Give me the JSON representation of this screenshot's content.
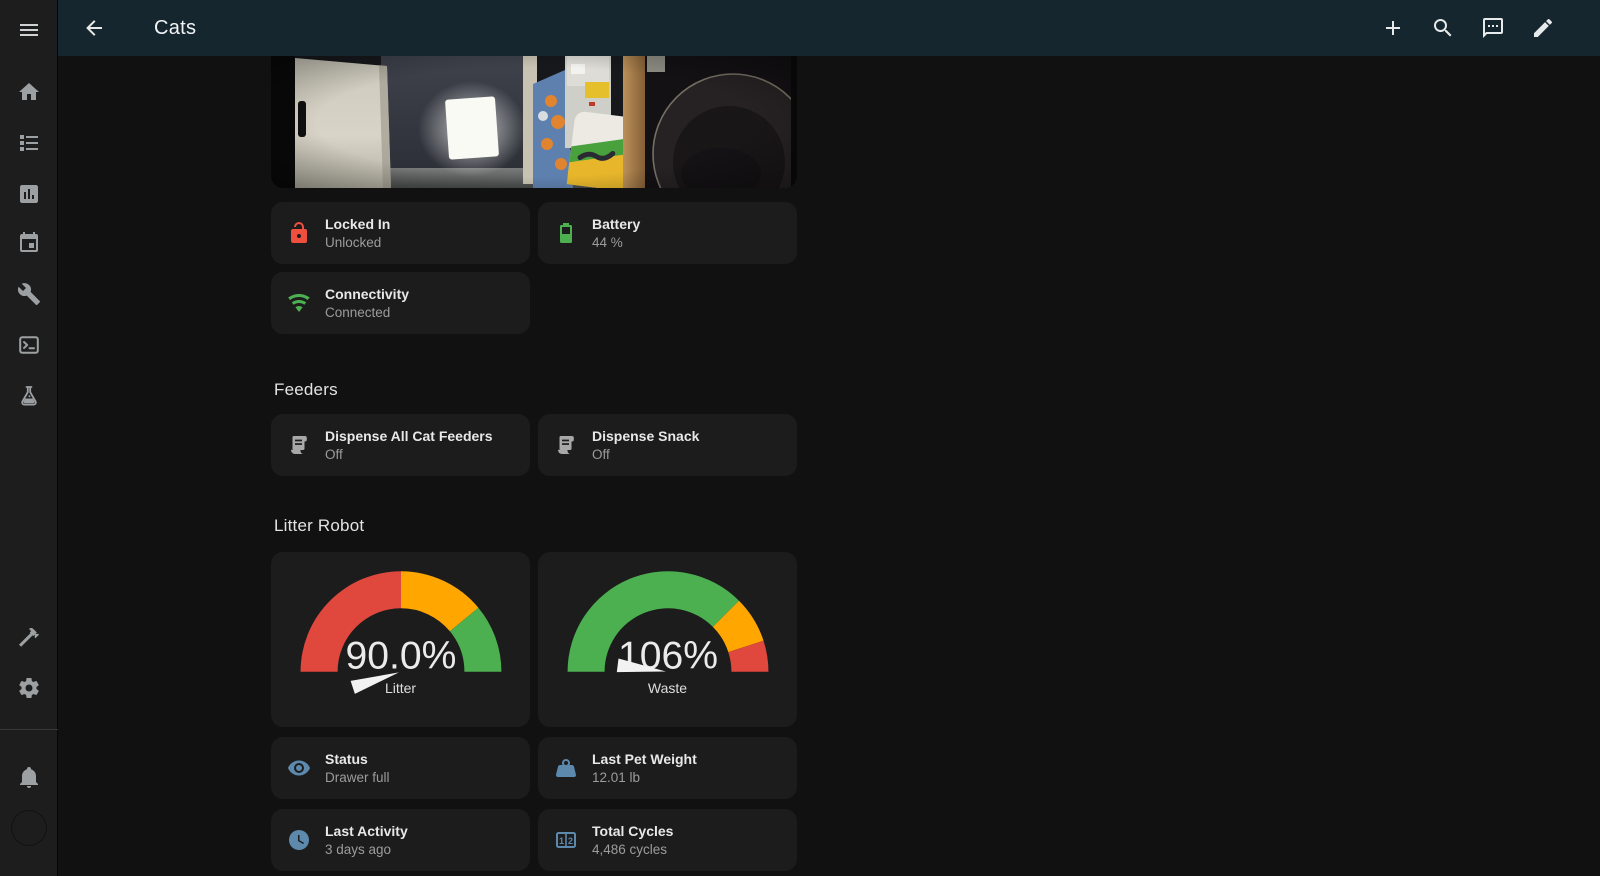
{
  "colors": {
    "header_bg": "#16262e",
    "sidebar_bg": "#1d1d1d",
    "page_bg": "#111111",
    "card_bg": "#1c1c1c",
    "accent_red": "#ee4f3e",
    "accent_green": "#4caf50",
    "accent_blue": "#5d89ad",
    "icon_gray": "#9da0a2",
    "text_primary": "#e8e8e8",
    "text_secondary": "#9c9c9c"
  },
  "header": {
    "title": "Cats",
    "actions": [
      "add",
      "search",
      "assist",
      "edit"
    ]
  },
  "sidebar": {
    "items": [
      "menu-icon",
      "home-icon",
      "list-icon",
      "bar-chart-icon",
      "calendar-icon",
      "wrench-icon",
      "terminal-icon",
      "flask-icon",
      "hammer-icon",
      "gear-icon",
      "bell-icon",
      "avatar"
    ]
  },
  "top_cards": [
    {
      "title": "Locked In",
      "value": "Unlocked",
      "icon": "lock-open-icon",
      "color": "red"
    },
    {
      "title": "Battery",
      "value": "44 %",
      "icon": "battery-icon",
      "color": "green"
    },
    {
      "title": "Connectivity",
      "value": "Connected",
      "icon": "wifi-icon",
      "color": "green"
    }
  ],
  "feeders": {
    "heading": "Feeders",
    "cards": [
      {
        "title": "Dispense All Cat Feeders",
        "value": "Off",
        "icon": "feeder-icon"
      },
      {
        "title": "Dispense Snack",
        "value": "Off",
        "icon": "feeder-icon"
      }
    ]
  },
  "litter_robot": {
    "heading": "Litter Robot",
    "cards": [
      {
        "title": "Status",
        "value": "Drawer full",
        "icon": "eye-icon"
      },
      {
        "title": "Last Pet Weight",
        "value": "12.01 lb",
        "icon": "weight-icon"
      },
      {
        "title": "Last Activity",
        "value": "3 days ago",
        "icon": "clock-icon"
      },
      {
        "title": "Total Cycles",
        "value": "4,486 cycles",
        "icon": "counter-icon"
      }
    ]
  },
  "gauges": [
    {
      "name": "Litter",
      "display": "90.0%",
      "value": 90.0,
      "min": 0,
      "max": 100,
      "segments": [
        {
          "from": 0,
          "color": "#e0483e"
        },
        {
          "from": 50,
          "color": "#ffa600"
        },
        {
          "from": 78,
          "color": "#4caf50"
        }
      ]
    },
    {
      "name": "Waste",
      "display": "106%",
      "value": 106,
      "min": 0,
      "max": 100,
      "segments": [
        {
          "from": 0,
          "color": "#4caf50"
        },
        {
          "from": 75,
          "color": "#ffa600"
        },
        {
          "from": 90,
          "color": "#e0483e"
        }
      ]
    }
  ]
}
